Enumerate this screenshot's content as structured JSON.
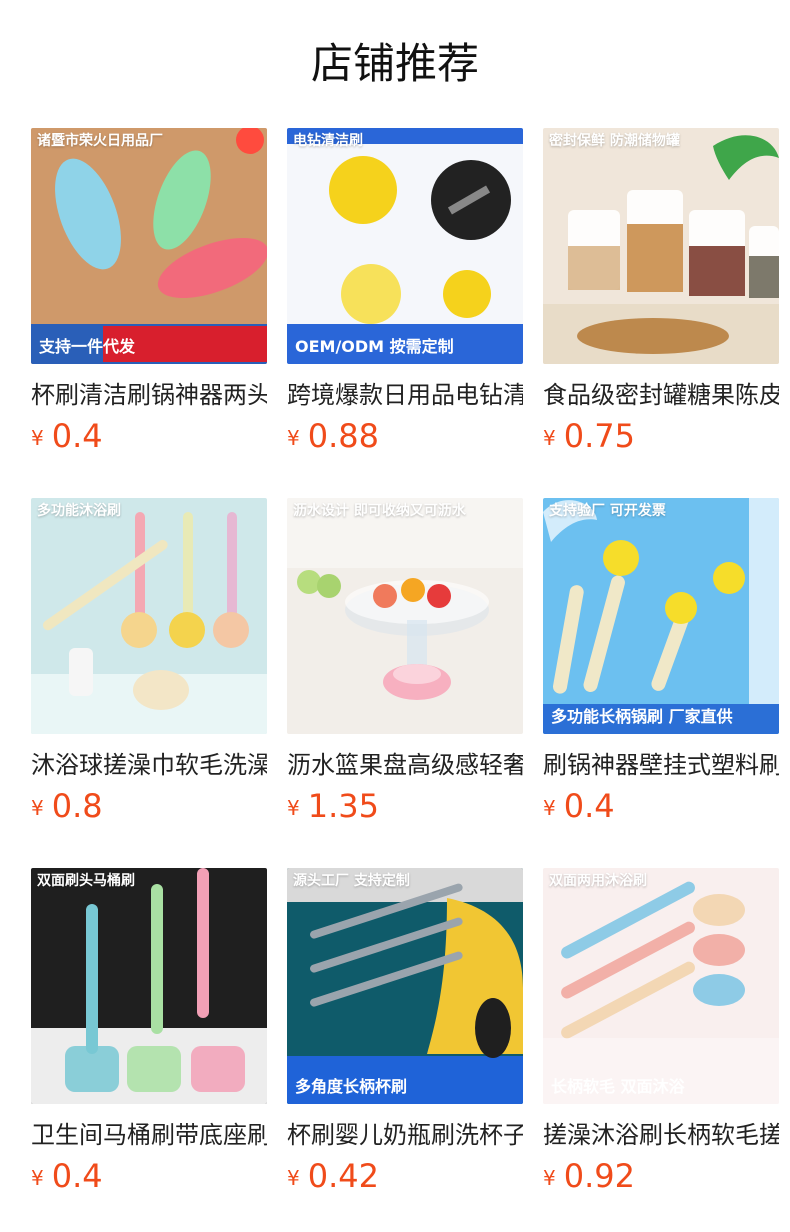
{
  "page": {
    "title": "店铺推荐"
  },
  "products": [
    {
      "title": "杯刷清洁刷锅神器两头",
      "currency": "¥",
      "price": "0.4",
      "image_top_text": "诸暨市荣火日用品厂",
      "image_bottom_text": "支持一件代发",
      "colors": {
        "bg": "#c98f5f",
        "accent": "#d81f2d",
        "item1": "#8fd3e8",
        "item2": "#8de0a8",
        "item3": "#f26a7b"
      }
    },
    {
      "title": "跨境爆款日用品电钻清洁刷",
      "currency": "¥",
      "price": "0.88",
      "image_top_text": "电钻清洁刷",
      "image_bottom_text": "OEM/ODM 按需定制",
      "colors": {
        "bg": "#f5f7fb",
        "accent": "#2a66d8",
        "item1": "#f5d21c",
        "item2": "#222222",
        "item3": "#f7e15a"
      }
    },
    {
      "title": "食品级密封罐糖果陈皮",
      "currency": "¥",
      "price": "0.75",
      "image_top_text": "密封保鲜 防潮储物罐",
      "image_bottom_text": "",
      "colors": {
        "bg": "#f0e6da",
        "accent": "#5b4a3a",
        "item1": "#d9b68b",
        "item2": "#ffffff",
        "item3": "#7c3b2f"
      }
    },
    {
      "title": "沐浴球搓澡巾软毛洗澡刷",
      "currency": "¥",
      "price": "0.8",
      "image_top_text": "多功能沐浴刷",
      "image_bottom_text": "",
      "colors": {
        "bg": "#cfe8ea",
        "accent": "#222222",
        "item1": "#f4a8b3",
        "item2": "#e8eab6",
        "item3": "#e6b8d3"
      }
    },
    {
      "title": "沥水篮果盘高级感轻奢",
      "currency": "¥",
      "price": "1.35",
      "image_top_text": "沥水设计 即可收纳又可沥水",
      "image_bottom_text": "",
      "colors": {
        "bg": "#f2eee9",
        "accent": "#b32222",
        "item1": "#e8f2e7",
        "item2": "#f07a5c",
        "item3": "#f7b0c0"
      }
    },
    {
      "title": "刷锅神器壁挂式塑料刷",
      "currency": "¥",
      "price": "0.4",
      "image_top_text": "支持验厂 可开发票",
      "image_bottom_text": "多功能长柄锅刷 厂家直供",
      "colors": {
        "bg": "#6cc0f0",
        "accent": "#e64b1f",
        "item1": "#f0e8c8",
        "item2": "#f6dd2a",
        "item3": "#2b6fd6"
      }
    },
    {
      "title": "卫生间马桶刷带底座刷",
      "currency": "¥",
      "price": "0.4",
      "image_top_text": "双面刷头马桶刷",
      "image_bottom_text": "",
      "colors": {
        "bg": "#1f1f1f",
        "accent": "#f5f5f5",
        "item1": "#78c8d4",
        "item2": "#a9e0a3",
        "item3": "#f2a0b6"
      }
    },
    {
      "title": "杯刷婴儿奶瓶刷洗杯子",
      "currency": "¥",
      "price": "0.42",
      "image_top_text": "源头工厂 支持定制",
      "image_bottom_text": "多角度长柄杯刷",
      "colors": {
        "bg": "#0f5b6a",
        "accent": "#1f63d8",
        "item1": "#9aa4ad",
        "item2": "#f1c633",
        "item3": "#1f1f1f"
      }
    },
    {
      "title": "搓澡沐浴刷长柄软毛搓",
      "currency": "¥",
      "price": "0.92",
      "image_top_text": "双面两用沐浴刷",
      "image_bottom_text": "长柄软毛 双面沐浴",
      "colors": {
        "bg": "#f7e8e7",
        "accent": "#d09a2d",
        "item1": "#8ecbe6",
        "item2": "#f2b0a8",
        "item3": "#f3d7b4"
      }
    }
  ]
}
